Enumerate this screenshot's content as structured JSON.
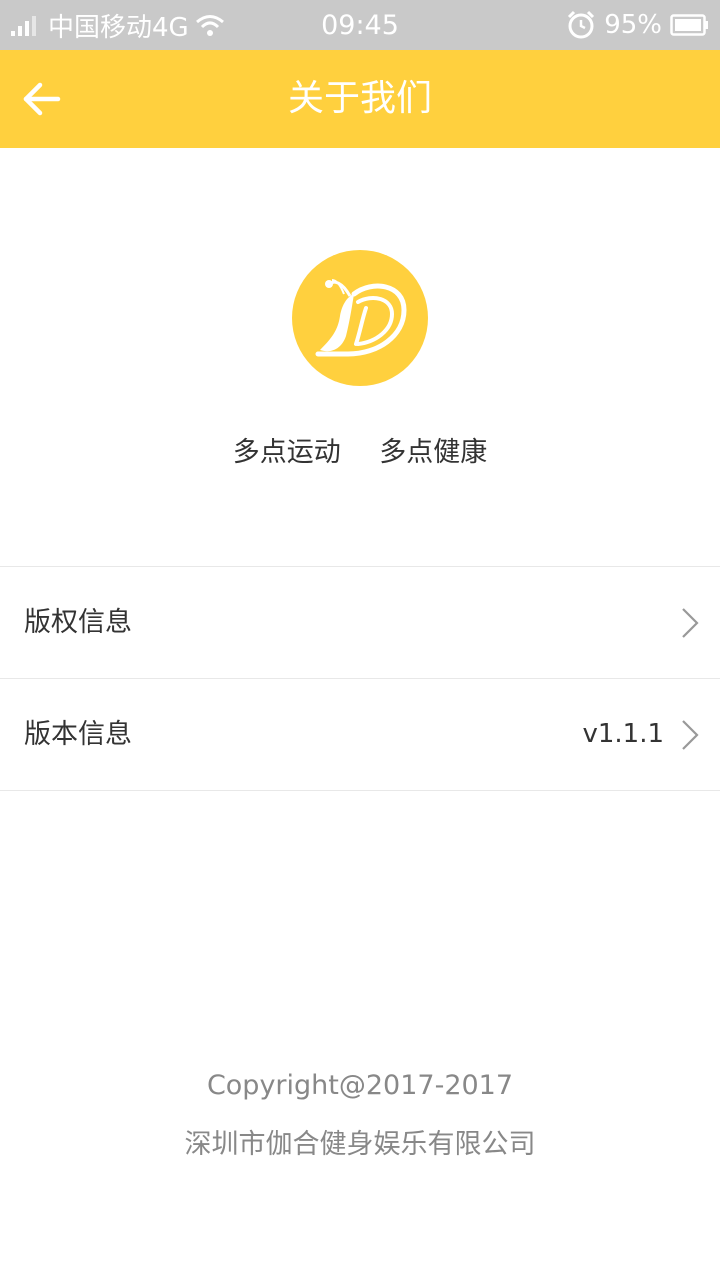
{
  "status_bar": {
    "carrier": "中国移动4G",
    "time": "09:45",
    "battery": "95%"
  },
  "header": {
    "title": "关于我们"
  },
  "brand": {
    "slogan_1": "多点运动",
    "slogan_2": "多点健康"
  },
  "menu": [
    {
      "label": "版权信息",
      "value": ""
    },
    {
      "label": "版本信息",
      "value": "v1.1.1"
    }
  ],
  "footer": {
    "copyright": "Copyright@2017-2017",
    "company": "深圳市伽合健身娱乐有限公司"
  },
  "colors": {
    "accent": "#ffd03e",
    "statusbar": "#c9c9c9",
    "text": "#333333",
    "muted": "#888888"
  }
}
